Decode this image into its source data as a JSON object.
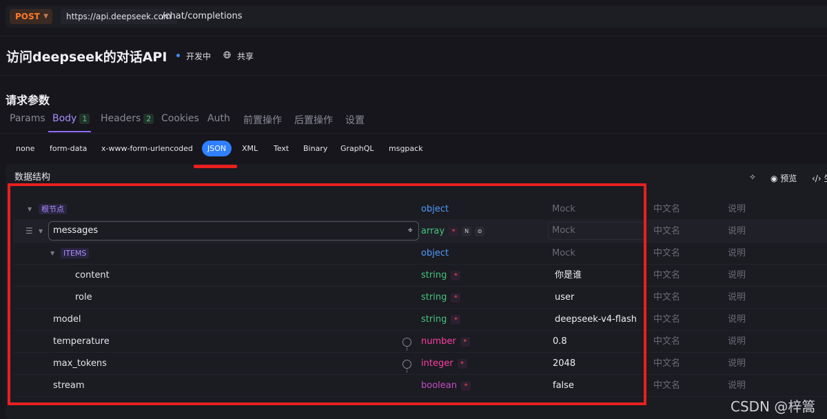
{
  "request": {
    "method": "POST",
    "host": "https://api.deepseek.com",
    "path": "/chat/completions"
  },
  "api": {
    "title": "访问deepseek的对话API",
    "status": "开发中",
    "share": "共享"
  },
  "section_title": "请求参数",
  "tabs": [
    {
      "label": "Params",
      "badge": ""
    },
    {
      "label": "Body",
      "badge": "1"
    },
    {
      "label": "Headers",
      "badge": "2"
    },
    {
      "label": "Cookies",
      "badge": ""
    },
    {
      "label": "Auth",
      "badge": ""
    },
    {
      "label": "前置操作",
      "badge": ""
    },
    {
      "label": "后置操作",
      "badge": ""
    },
    {
      "label": "设置",
      "badge": ""
    }
  ],
  "body_types": [
    "none",
    "form-data",
    "x-www-form-urlencoded",
    "JSON",
    "XML",
    "Text",
    "Binary",
    "GraphQL",
    "msgpack"
  ],
  "panel": {
    "title": "数据结构",
    "preview": "预览",
    "generate": "生"
  },
  "columns": {
    "mock_placeholder": "Mock",
    "cn_name_placeholder": "中文名",
    "desc_placeholder": "说明"
  },
  "rows": [
    {
      "name": "根节点",
      "type": "object",
      "required": false,
      "mock": "Mock"
    },
    {
      "name": "messages",
      "type": "array",
      "required": true,
      "mock": "Mock"
    },
    {
      "name": "ITEMS",
      "type": "object",
      "required": false,
      "mock": "Mock"
    },
    {
      "name": "content",
      "type": "string",
      "required": true,
      "mock": "你是谁"
    },
    {
      "name": "role",
      "type": "string",
      "required": true,
      "mock": "user"
    },
    {
      "name": "model",
      "type": "string",
      "required": true,
      "mock": "deepseek-v4-flash"
    },
    {
      "name": "temperature",
      "type": "number",
      "required": true,
      "mock": "0.8"
    },
    {
      "name": "max_tokens",
      "type": "integer",
      "required": true,
      "mock": "2048"
    },
    {
      "name": "stream",
      "type": "boolean",
      "required": true,
      "mock": "false"
    }
  ],
  "watermark": "CSDN @梓篙",
  "icons": {
    "required": "asterisk",
    "info": "info-circle-icon"
  },
  "colors": {
    "accent": "#a98cff",
    "method": "#ff7a2a",
    "json_active": "#2f7fff",
    "annotation_red": "#e8201f"
  }
}
